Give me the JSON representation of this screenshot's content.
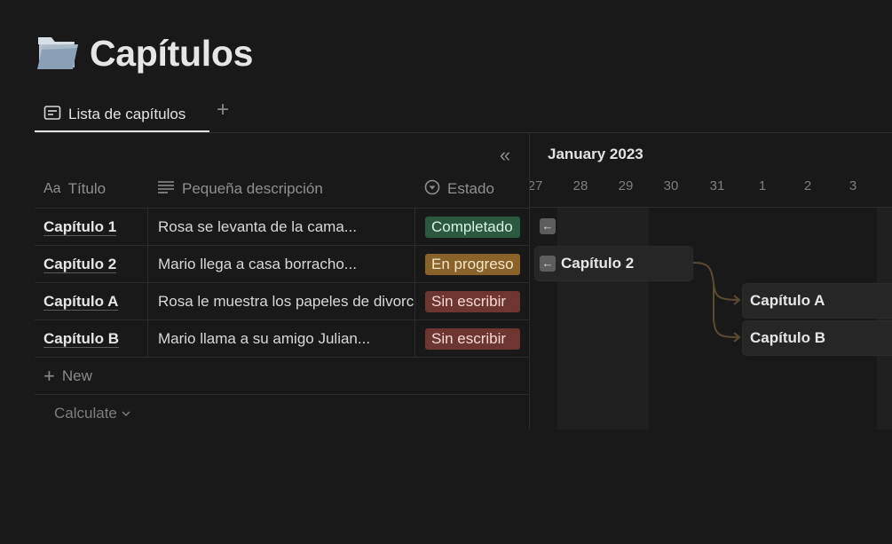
{
  "page": {
    "title": "Capítulos",
    "icon": "folder-icon"
  },
  "views": {
    "active_tab": "Lista de capítulos",
    "add_icon": "plus-icon"
  },
  "table": {
    "columns": [
      {
        "label": "Título",
        "prefix": "Aa",
        "icon": "title-icon"
      },
      {
        "label": "Pequeña descripción",
        "icon": "text-lines-icon"
      },
      {
        "label": "Estado",
        "icon": "status-icon"
      }
    ],
    "rows": [
      {
        "title": "Capítulo 1",
        "desc": "Rosa se levanta de la cama...",
        "estado": "Completado",
        "estado_color": "#2b593f",
        "estado_text_color": "#d9f2e3"
      },
      {
        "title": "Capítulo 2",
        "desc": "Mario llega a casa borracho...",
        "estado": "En progreso",
        "estado_color": "#89632a",
        "estado_text_color": "#f5e6c8"
      },
      {
        "title": "Capítulo A",
        "desc": "Rosa le muestra los papeles de divorcio",
        "estado": "Sin escribir",
        "estado_color": "#6e3630",
        "estado_text_color": "#f6d9d5"
      },
      {
        "title": "Capítulo B",
        "desc": "Mario llama a su amigo Julian...",
        "estado": "Sin escribir",
        "estado_color": "#6e3630",
        "estado_text_color": "#f6d9d5"
      }
    ],
    "new_label": "New",
    "calculate_label": "Calculate"
  },
  "timeline": {
    "month": "January 2023",
    "days": [
      "27",
      "28",
      "29",
      "30",
      "31",
      "1",
      "2",
      "3"
    ],
    "bars": [
      {
        "label": "Capítulo 2"
      },
      {
        "label": "Capítulo A"
      },
      {
        "label": "Capítulo B"
      }
    ]
  },
  "colors": {
    "background": "#191919",
    "dependency_line": "#5a4a2f"
  }
}
